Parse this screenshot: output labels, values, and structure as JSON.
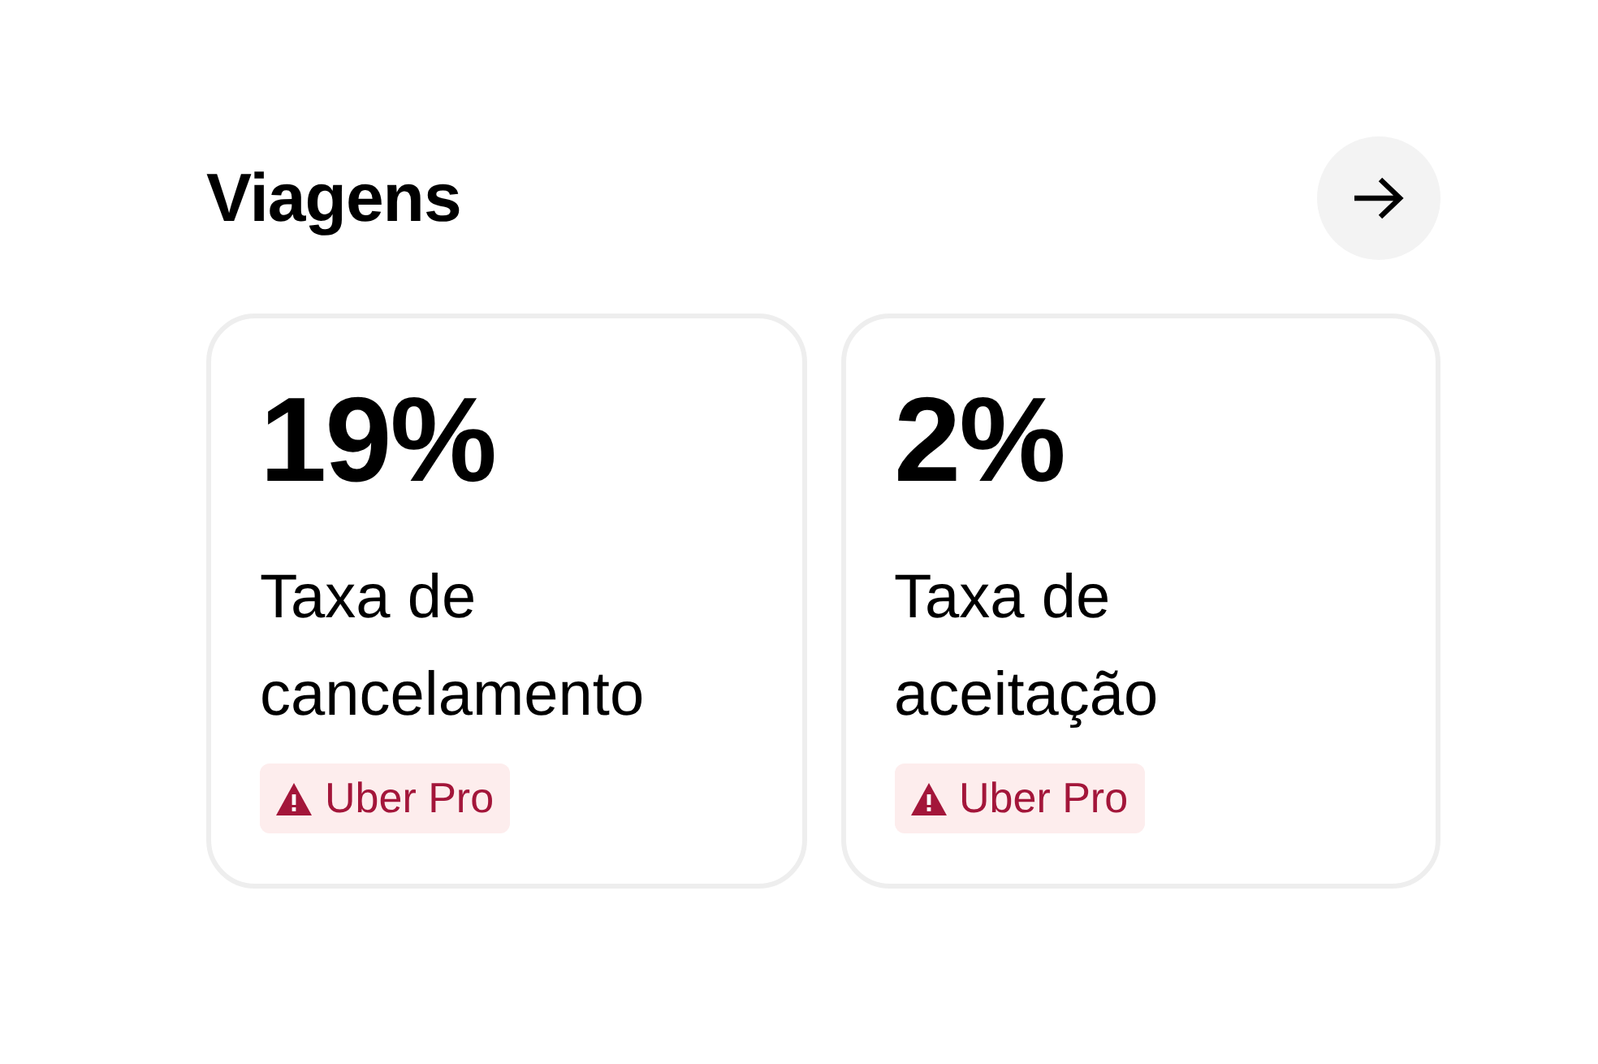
{
  "section": {
    "title": "Viagens"
  },
  "cards": [
    {
      "value": "19%",
      "label": "Taxa de cancelamento",
      "tag": "Uber Pro"
    },
    {
      "value": "2%",
      "label": "Taxa de aceitação",
      "tag": "Uber Pro"
    }
  ]
}
